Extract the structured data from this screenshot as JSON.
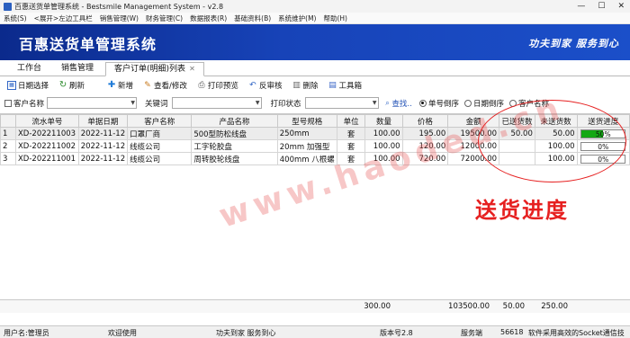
{
  "window": {
    "title": "百惠送货单管理系统 - Bestsmile Management System - v2.8",
    "controls": [
      "—",
      "☐",
      "✕"
    ]
  },
  "menu": [
    "系统(S)",
    "<展开>左边工具栏",
    "销售管理(W)",
    "财务管理(C)",
    "数据报表(R)",
    "基础资料(B)",
    "系统维护(M)",
    "帮助(H)"
  ],
  "banner": {
    "title": "百惠送货单管理系统",
    "slogan": "功夫到家  服务到心"
  },
  "tabs": [
    {
      "label": "工作台"
    },
    {
      "label": "销售管理"
    },
    {
      "label": "客户订单(明细)列表",
      "close": "✕"
    }
  ],
  "toolbar": [
    {
      "label": "日期选择",
      "icon": "calendar-icon"
    },
    {
      "label": "刷新",
      "icon": "refresh-icon"
    },
    {
      "label": "新增",
      "icon": "add-icon"
    },
    {
      "label": "查看/修改",
      "icon": "edit-icon"
    },
    {
      "label": "打印预览",
      "icon": "print-icon"
    },
    {
      "label": "反审核",
      "icon": "undo-icon"
    },
    {
      "label": "删除",
      "icon": "delete-icon"
    },
    {
      "label": "工具箱",
      "icon": "toolbox-icon"
    }
  ],
  "filters": {
    "customer_label": "客户名称",
    "keyword_label": "关键词",
    "print_status_label": "打印状态",
    "search_label": "查找..",
    "sort_options": [
      "单号倒序",
      "日期倒序",
      "客户名称"
    ],
    "selected_sort": 0
  },
  "table": {
    "columns": [
      "",
      "流水单号",
      "单据日期",
      "客户名称",
      "产品名称",
      "型号规格",
      "单位",
      "数量",
      "价格",
      "金额",
      "已送货数",
      "未送货数",
      "送货进度"
    ],
    "rows": [
      {
        "idx": "1",
        "no": "XD-202211003",
        "date": "2022-11-12",
        "customer": "口罩厂商",
        "product": "500型防松线盘",
        "spec": "250mm",
        "unit": "套",
        "qty": "100.00",
        "price": "195.00",
        "amount": "19500.00",
        "delivered": "50.00",
        "pending": "50.00",
        "progress_text": "50%",
        "progress": 50
      },
      {
        "idx": "2",
        "no": "XD-202211002",
        "date": "2022-11-12",
        "customer": "线缆公司",
        "product": "工字轮胶盘",
        "spec": "20mm 加强型",
        "unit": "套",
        "qty": "100.00",
        "price": "120.00",
        "amount": "12000.00",
        "delivered": "",
        "pending": "100.00",
        "progress_text": "0%",
        "progress": 0
      },
      {
        "idx": "3",
        "no": "XD-202211001",
        "date": "2022-11-12",
        "customer": "线缆公司",
        "product": "周转胶轮线盘",
        "spec": "400mm 八根螺",
        "unit": "套",
        "qty": "100.00",
        "price": "720.00",
        "amount": "72000.00",
        "delivered": "",
        "pending": "100.00",
        "progress_text": "0%",
        "progress": 0
      }
    ],
    "totals": {
      "qty": "300.00",
      "amount": "103500.00",
      "delivered": "50.00",
      "pending": "250.00"
    }
  },
  "status": {
    "user": "用户名:管理员",
    "welcome": "欢迎使用",
    "motto": "功夫到家 服务到心",
    "version": "版本号2.8",
    "server": "服务端",
    "port": "56618",
    "socket_note": "软件采用高效的Socket通信技"
  },
  "annotation": {
    "text": "送货进度"
  },
  "watermark": "www.haoded.cn",
  "colors": {
    "banner": "#1743b8",
    "progress_fill": "#13a813",
    "annotation": "#e62020"
  }
}
